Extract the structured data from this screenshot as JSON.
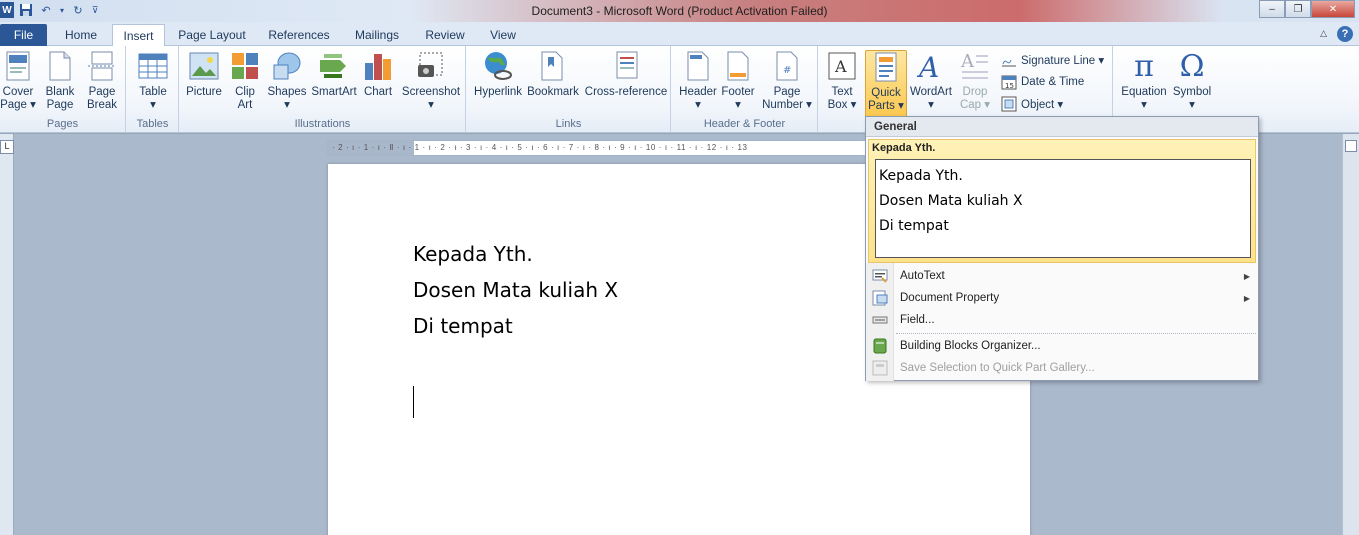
{
  "window": {
    "title": "Document3  -  Microsoft Word (Product Activation Failed)",
    "minimize": "‒",
    "restore": "❐",
    "close": "✕",
    "help": "?"
  },
  "tabs": [
    "File",
    "Home",
    "Insert",
    "Page Layout",
    "References",
    "Mailings",
    "Review",
    "View"
  ],
  "ribbon": {
    "pages": {
      "label": "Pages",
      "cover_page": "Cover\nPage ▾",
      "blank_page": "Blank\nPage",
      "page_break": "Page\nBreak"
    },
    "tables": {
      "label": "Tables",
      "table": "Table\n▾"
    },
    "illustrations": {
      "label": "Illustrations",
      "picture": "Picture",
      "clip_art": "Clip\nArt",
      "shapes": "Shapes\n▾",
      "smartart": "SmartArt",
      "chart": "Chart",
      "screenshot": "Screenshot\n▾"
    },
    "links": {
      "label": "Links",
      "hyperlink": "Hyperlink",
      "bookmark": "Bookmark",
      "cross_reference": "Cross-reference"
    },
    "header_footer": {
      "label": "Header & Footer",
      "header": "Header\n▾",
      "footer": "Footer\n▾",
      "page_number": "Page\nNumber ▾"
    },
    "text": {
      "text_box": "Text\nBox ▾",
      "quick_parts": "Quick\nParts ▾",
      "wordart": "WordArt\n▾",
      "drop_cap": "Drop\nCap ▾",
      "signature_line": "Signature Line ▾",
      "date_time": "Date & Time",
      "object": "Object ▾"
    },
    "symbols": {
      "equation": "Equation\n▾",
      "symbol": "Symbol\n▾"
    }
  },
  "document": {
    "lines": [
      "Kepada Yth.",
      "Dosen Mata kuliah X",
      "Di tempat"
    ]
  },
  "quick_parts_menu": {
    "section_header": "General",
    "gallery_item_title": "Kepada Yth.",
    "gallery_preview": [
      "Kepada Yth.",
      "Dosen Mata kuliah X",
      "Di tempat"
    ],
    "items": [
      {
        "label": "AutoText",
        "submenu": true,
        "enabled": true
      },
      {
        "label": "Document Property",
        "submenu": true,
        "enabled": true
      },
      {
        "label": "Field...",
        "submenu": false,
        "enabled": true
      },
      {
        "label": "Building Blocks Organizer...",
        "submenu": false,
        "enabled": true
      },
      {
        "label": "Save Selection to Quick Part Gallery...",
        "submenu": false,
        "enabled": false
      }
    ]
  },
  "ruler_numbers": "· 2 · ı · 1 · ı · Ⅱ · ı · 1 · ı · 2 · ı · 3 · ı · 4 · ı · 5 · ı · 6 · ı · 7 · ı · 8 · ı · 9 · ı · 10 · ı · 11 · ı · 12 · ı · 13",
  "colors": {
    "accent": "#2b5797",
    "selected_button": "#fbc84f",
    "gallery_highlight": "#fde28a"
  }
}
